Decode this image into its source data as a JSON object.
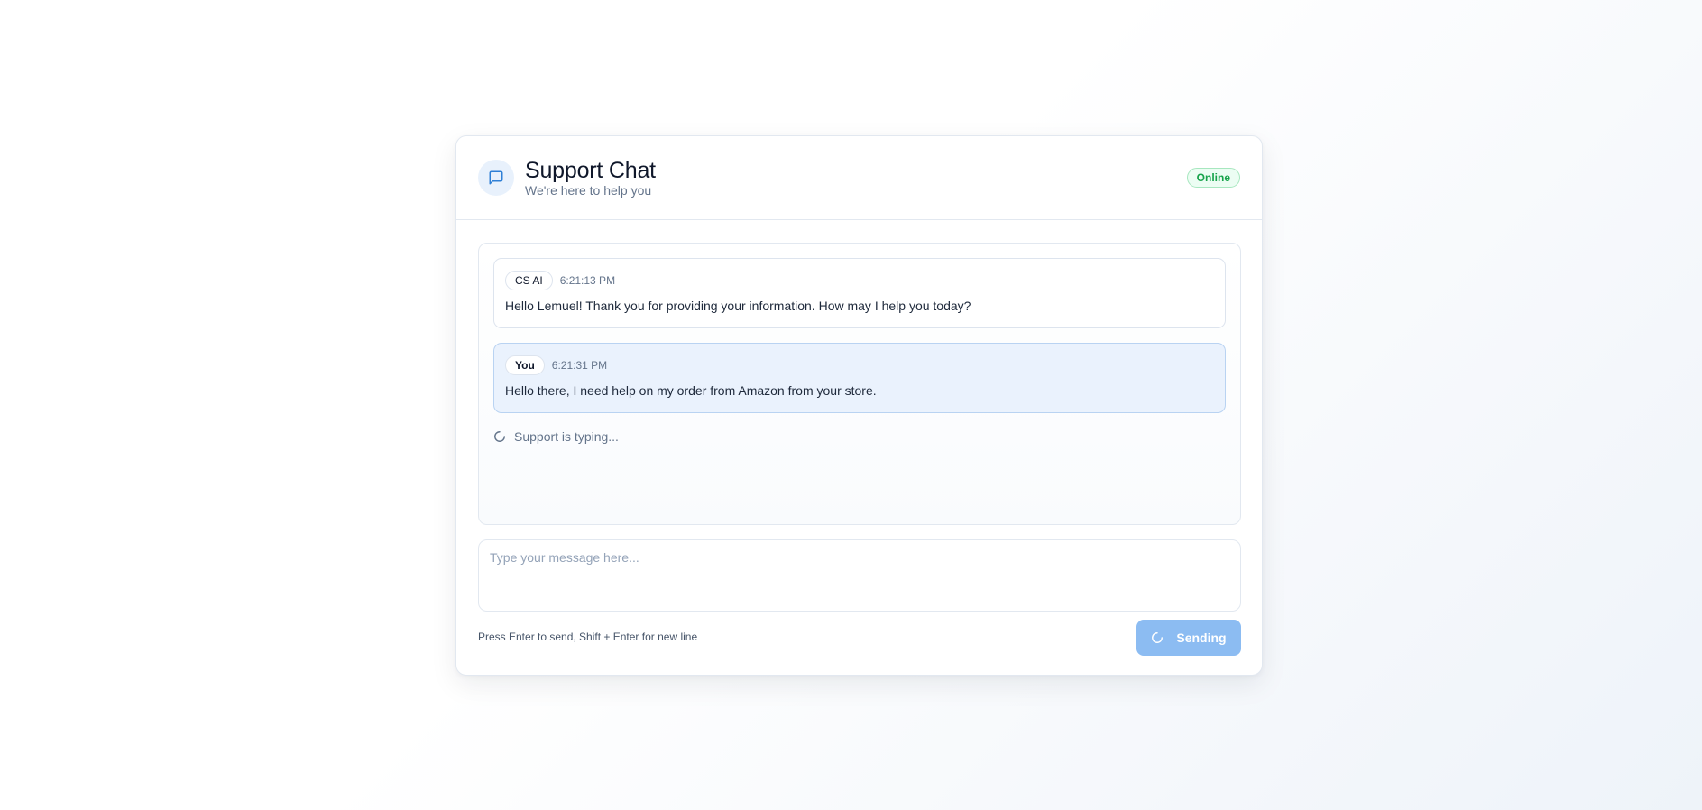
{
  "header": {
    "title": "Support Chat",
    "subtitle": "We're here to help you",
    "status": "Online",
    "icon": "chat-bubble-icon"
  },
  "messages": [
    {
      "sender": "CS AI",
      "time": "6:21:13 PM",
      "text": "Hello Lemuel! Thank you for providing your information. How may I help you today?"
    },
    {
      "sender": "You",
      "time": "6:21:31 PM",
      "text": "Hello there, I need help on my order from Amazon from your store."
    }
  ],
  "typing_indicator": "Support is typing...",
  "composer": {
    "placeholder": "Type your message here...",
    "value": "",
    "hint": "Press Enter to send, Shift + Enter for new line",
    "send_label": "Sending"
  },
  "colors": {
    "accent": "#2f80d6",
    "status_green": "#16a34a",
    "send_button_bg": "#8cbcf2",
    "user_bubble_bg": "#eaf2fd"
  }
}
